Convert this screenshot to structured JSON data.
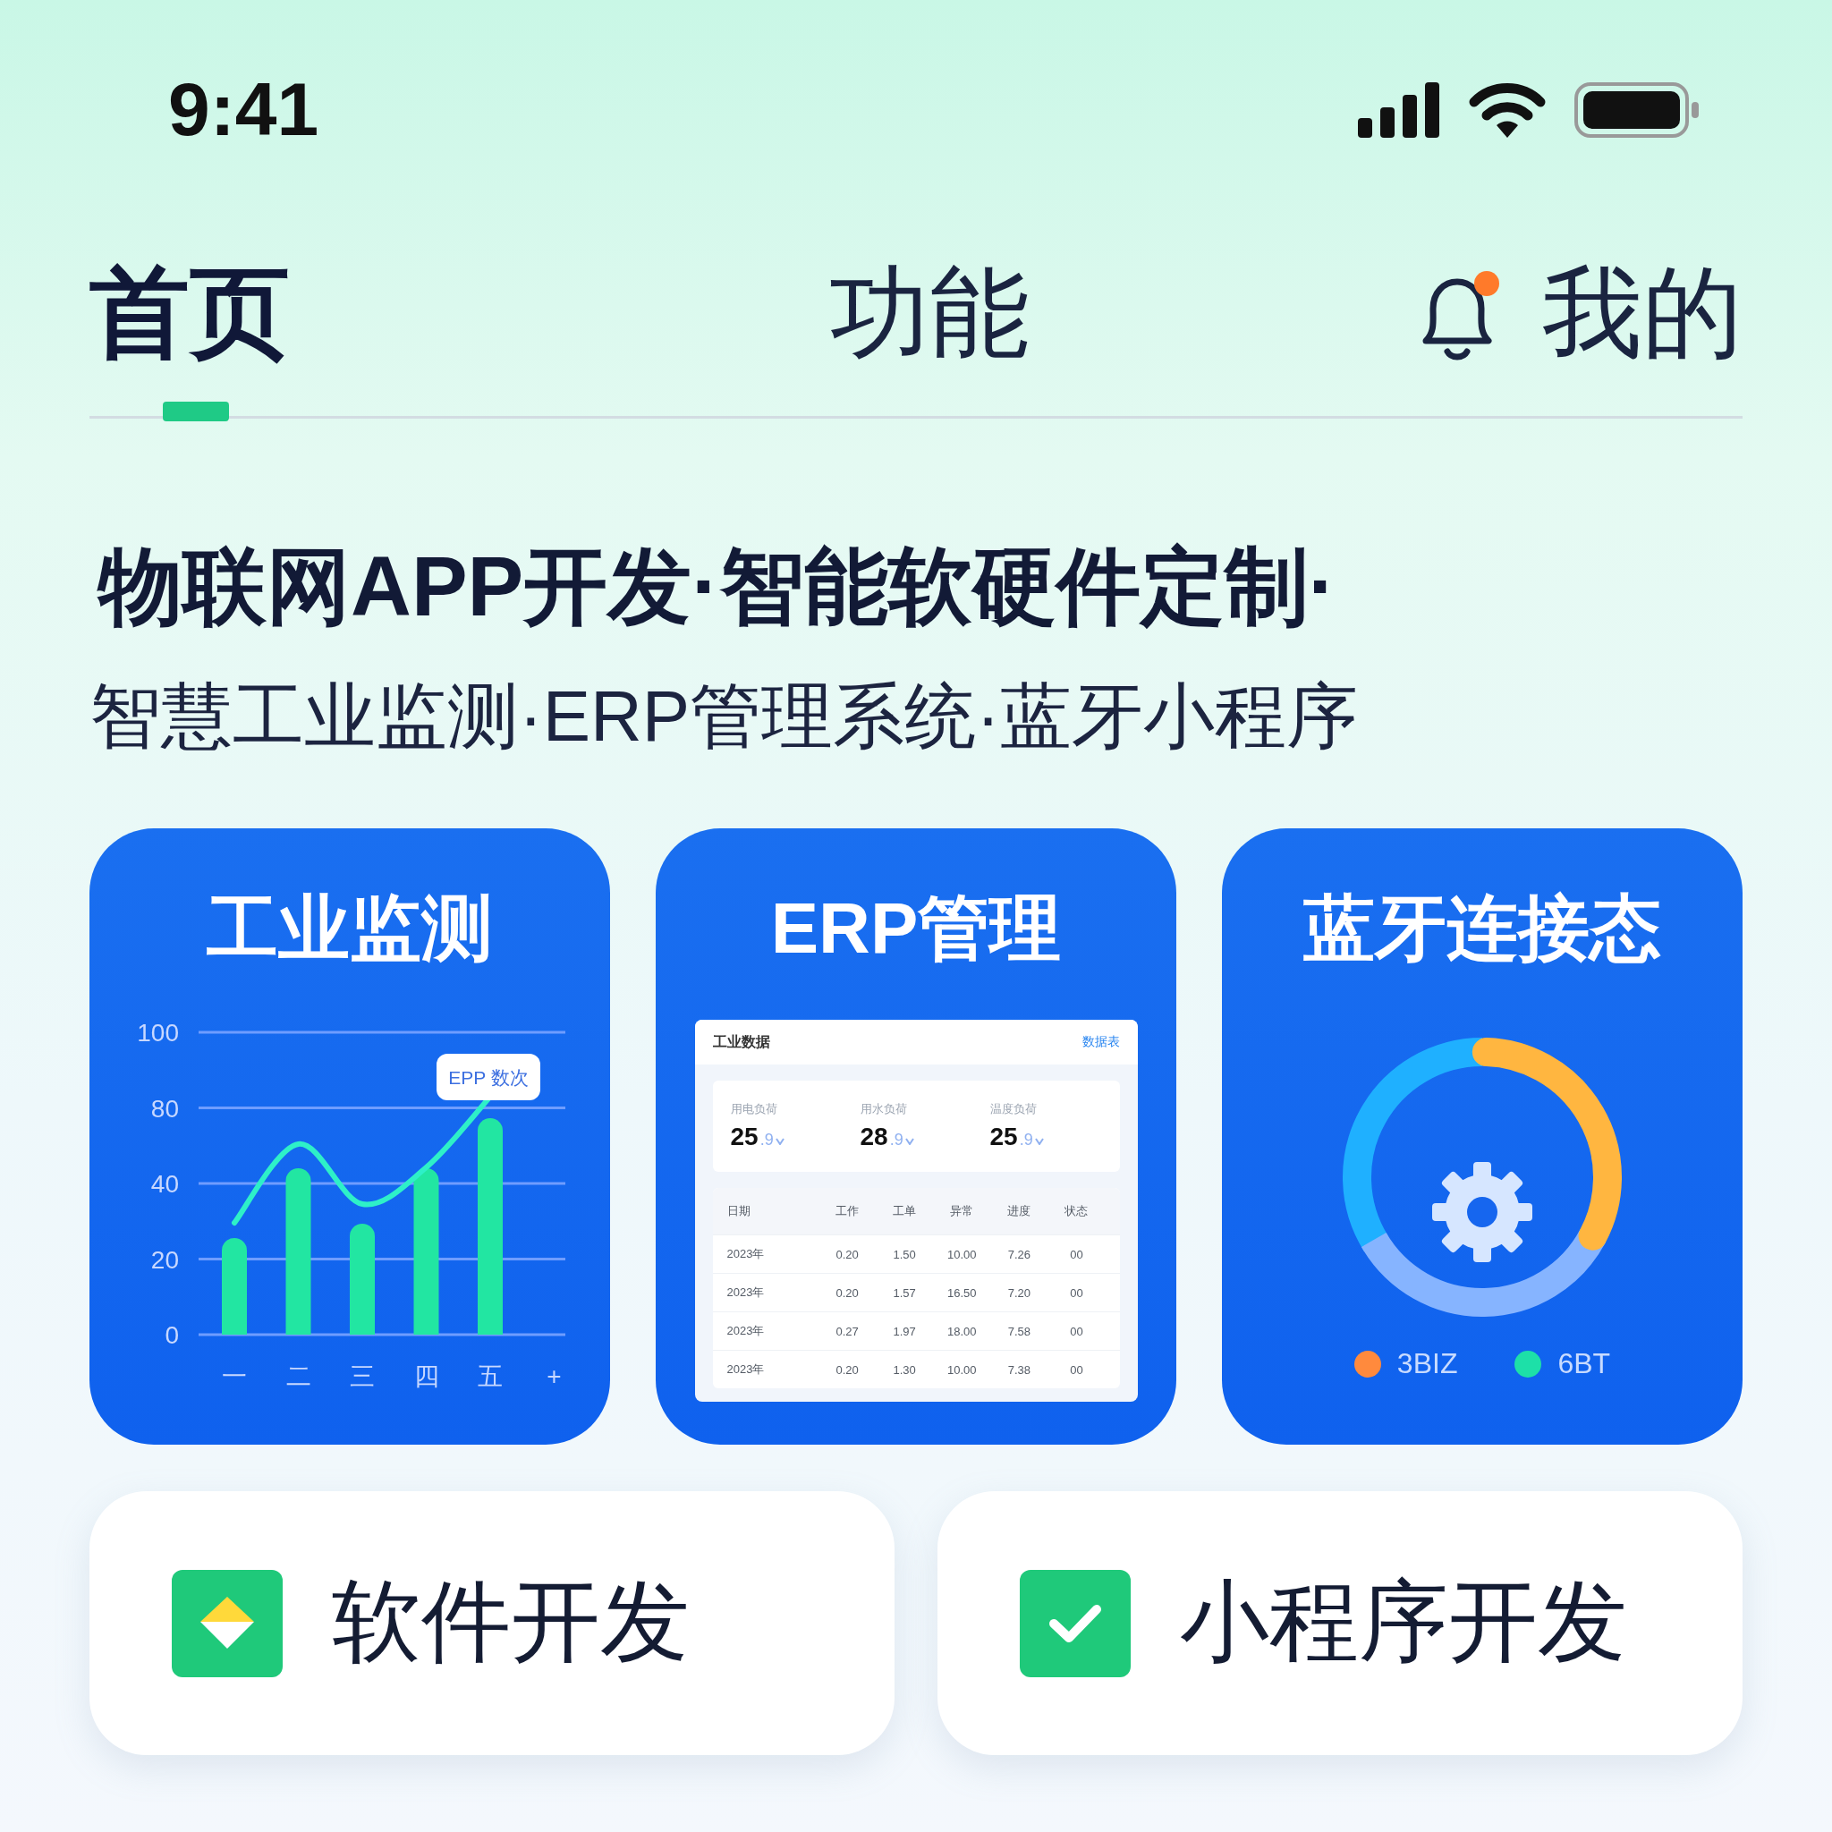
{
  "status_bar": {
    "time": "9:41"
  },
  "tabs": [
    {
      "label": "首页",
      "selected": true
    },
    {
      "label": "功能",
      "selected": false
    },
    {
      "label": "我的",
      "selected": false
    }
  ],
  "notification_dot": true,
  "headline": "物联网APP开发·智能软硬件定制·",
  "subtitle": "智慧工业监测·ERP管理系统·蓝牙小程序",
  "cards": [
    {
      "kind": "chart",
      "title": "工业监测",
      "y_labels": [
        "100",
        "80",
        "40",
        "20",
        "0"
      ],
      "x_labels": [
        "一",
        "二",
        "三",
        "四",
        "五",
        "+"
      ],
      "tooltip": "EPP 数次"
    },
    {
      "kind": "erp",
      "title": "ERP管理",
      "panel": {
        "title": "工业数据",
        "link": "数据表",
        "stats": [
          {
            "label": "用电负荷",
            "value": "25",
            "decimal": ".9"
          },
          {
            "label": "用水负荷",
            "value": "28",
            "decimal": ".9"
          },
          {
            "label": "温度负荷",
            "value": "25",
            "decimal": ".9"
          }
        ],
        "columns": [
          "日期",
          "工作",
          "工单",
          "异常",
          "进度",
          "状态"
        ],
        "rows": [
          [
            "2023年",
            "0.20",
            "1.50",
            "10.00",
            "7.26",
            "00"
          ],
          [
            "2023年",
            "0.20",
            "1.57",
            "16.50",
            "7.20",
            "00"
          ],
          [
            "2023年",
            "0.27",
            "1.97",
            "18.00",
            "7.58",
            "00"
          ],
          [
            "2023年",
            "0.20",
            "1.30",
            "10.00",
            "7.38",
            "00"
          ]
        ]
      }
    },
    {
      "kind": "donut",
      "title": "蓝牙连接态",
      "legend": [
        {
          "label": "3BIZ",
          "color": "#ff8a3d"
        },
        {
          "label": "6BT",
          "color": "#1de0a8"
        }
      ]
    }
  ],
  "actions": [
    {
      "label": "软件开发",
      "kind": "diamond"
    },
    {
      "label": "小程序开发",
      "kind": "check"
    }
  ]
}
